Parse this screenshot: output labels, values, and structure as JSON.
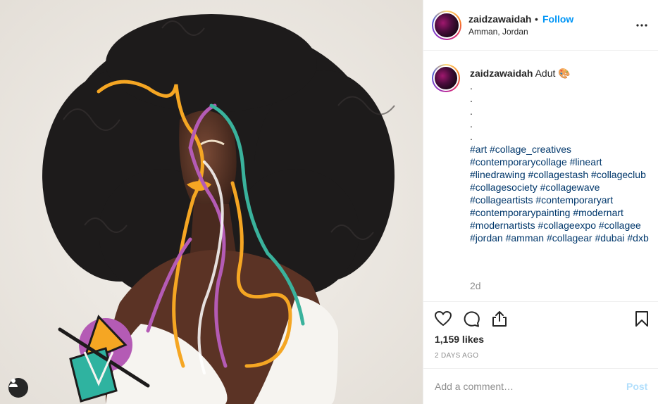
{
  "colors": {
    "follow_blue": "#0095f6",
    "hashtag_navy": "#00376b",
    "post_disabled": "#b2dffc",
    "secondary_gray": "#8e8e8e"
  },
  "header": {
    "username": "zaidzawaidah",
    "separator": "•",
    "follow_label": "Follow",
    "location": "Amman, Jordan",
    "more_icon": "more-horizontal-icon"
  },
  "caption": {
    "username": "zaidzawaidah",
    "first_line": "Adut 🎨",
    "dots": [
      ".",
      ".",
      ".",
      ".",
      "."
    ],
    "hashtags": [
      "#art",
      "#collage_creatives",
      "#contemporarycollage",
      "#lineart",
      "#linedrawing",
      "#collagestash",
      "#collageclub",
      "#collagesociety",
      "#collagewave",
      "#collageartists",
      "#contemporaryart",
      "#contemporarypainting",
      "#modernart",
      "#modernartists",
      "#collageexpo",
      "#collagee",
      "#jordan",
      "#amman",
      "#collagear",
      "#dubai",
      "#dxb"
    ],
    "time": "2d"
  },
  "actions": {
    "like_icon": "heart-icon",
    "comment_icon": "comment-icon",
    "share_icon": "share-icon",
    "save_icon": "bookmark-icon",
    "likes_text": "1,159 likes",
    "posted_ago": "2 DAYS AGO"
  },
  "comment_bar": {
    "placeholder": "Add a comment…",
    "post_label": "Post"
  },
  "media": {
    "user_tag_icon": "user-icon"
  }
}
